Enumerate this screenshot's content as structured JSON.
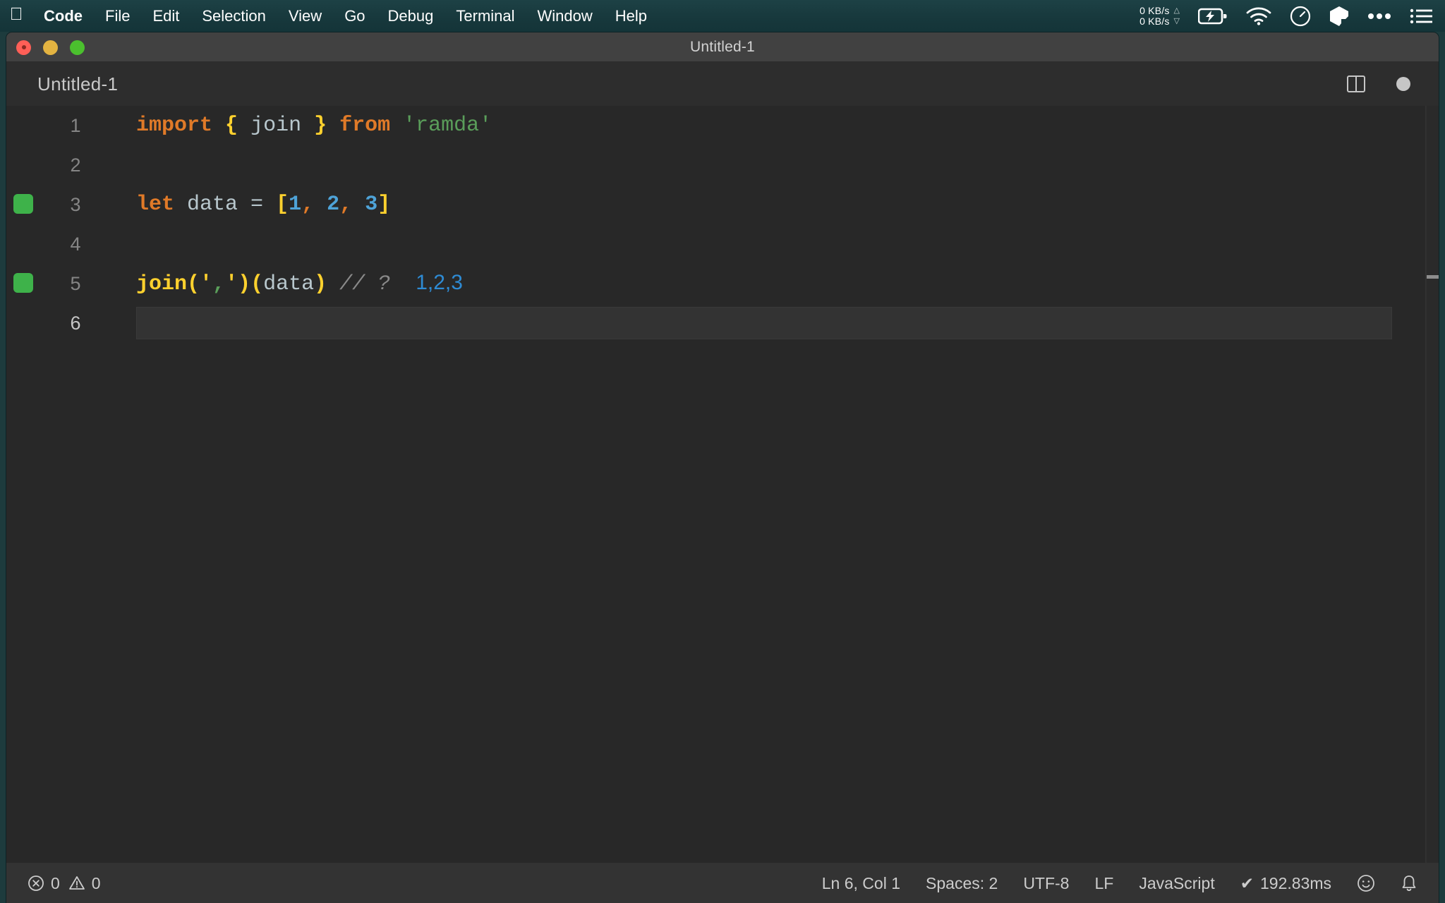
{
  "menubar": {
    "apple_icon": "apple-icon",
    "items": [
      {
        "label": "Code",
        "bold": true
      },
      {
        "label": "File",
        "bold": false
      },
      {
        "label": "Edit",
        "bold": false
      },
      {
        "label": "Selection",
        "bold": false
      },
      {
        "label": "View",
        "bold": false
      },
      {
        "label": "Go",
        "bold": false
      },
      {
        "label": "Debug",
        "bold": false
      },
      {
        "label": "Terminal",
        "bold": false
      },
      {
        "label": "Window",
        "bold": false
      },
      {
        "label": "Help",
        "bold": false
      }
    ],
    "status": {
      "net_up": "0 KB/s",
      "net_down": "0 KB/s",
      "arrow_up": "△",
      "arrow_down": "▽",
      "icons": [
        "battery-charging-icon",
        "wifi-icon",
        "timer-icon",
        "cube-icon",
        "ellipsis-icon",
        "list-icon"
      ]
    },
    "background_color": "#17383c"
  },
  "window": {
    "title": "Untitled-1",
    "traffic_lights": [
      "close-button",
      "minimize-button",
      "maximize-button"
    ]
  },
  "editor": {
    "tab_title": "Untitled-1",
    "actions": [
      "split-editor-icon",
      "unsaved-indicator"
    ],
    "lines": [
      {
        "number": "1",
        "marker": false,
        "active": false,
        "tokens": [
          {
            "text": "import",
            "cls": "t-kw"
          },
          {
            "text": " ",
            "cls": "t-var"
          },
          {
            "text": "{",
            "cls": "t-brace"
          },
          {
            "text": " join ",
            "cls": "t-var"
          },
          {
            "text": "}",
            "cls": "t-brace"
          },
          {
            "text": " ",
            "cls": "t-var"
          },
          {
            "text": "from",
            "cls": "t-kw"
          },
          {
            "text": " ",
            "cls": "t-var"
          },
          {
            "text": "'ramda'",
            "cls": "t-str"
          }
        ]
      },
      {
        "number": "2",
        "marker": false,
        "active": false,
        "tokens": []
      },
      {
        "number": "3",
        "marker": true,
        "active": false,
        "tokens": [
          {
            "text": "let",
            "cls": "t-kw"
          },
          {
            "text": " data ",
            "cls": "t-var"
          },
          {
            "text": "=",
            "cls": "t-punc"
          },
          {
            "text": " ",
            "cls": "t-var"
          },
          {
            "text": "[",
            "cls": "t-brace"
          },
          {
            "text": "1",
            "cls": "t-num"
          },
          {
            "text": ",",
            "cls": "t-comma"
          },
          {
            "text": " ",
            "cls": "t-var"
          },
          {
            "text": "2",
            "cls": "t-num"
          },
          {
            "text": ",",
            "cls": "t-comma"
          },
          {
            "text": " ",
            "cls": "t-var"
          },
          {
            "text": "3",
            "cls": "t-num"
          },
          {
            "text": "]",
            "cls": "t-brace"
          }
        ]
      },
      {
        "number": "4",
        "marker": false,
        "active": false,
        "tokens": []
      },
      {
        "number": "5",
        "marker": true,
        "active": false,
        "tokens": [
          {
            "text": "join",
            "cls": "t-fn"
          },
          {
            "text": "(",
            "cls": "t-paren"
          },
          {
            "text": "'",
            "cls": "t-strq"
          },
          {
            "text": ",",
            "cls": "t-strc"
          },
          {
            "text": "'",
            "cls": "t-strq"
          },
          {
            "text": ")",
            "cls": "t-paren"
          },
          {
            "text": "(",
            "cls": "t-paren"
          },
          {
            "text": "data",
            "cls": "t-var"
          },
          {
            "text": ")",
            "cls": "t-paren"
          },
          {
            "text": " ",
            "cls": "t-var"
          },
          {
            "text": "// ?",
            "cls": "t-cmt"
          },
          {
            "text": "  ",
            "cls": "t-var"
          },
          {
            "text": "1,2,3",
            "cls": "t-result"
          }
        ]
      },
      {
        "number": "6",
        "marker": false,
        "active": true,
        "tokens": []
      }
    ],
    "background_color": "#282828",
    "current_line_color": "#333333",
    "marker_color": "#3eb24a"
  },
  "statusbar": {
    "errors_icon": "error-circle-icon",
    "errors_count": "0",
    "warnings_icon": "warning-triangle-icon",
    "warnings_count": "0",
    "cursor_position": "Ln 6, Col 1",
    "indentation": "Spaces: 2",
    "encoding": "UTF-8",
    "eol": "LF",
    "language": "JavaScript",
    "run_check": "✔",
    "run_time": "192.83ms",
    "feedback_icon": "smiley-icon",
    "notifications_icon": "bell-icon",
    "background_color": "#333333"
  }
}
